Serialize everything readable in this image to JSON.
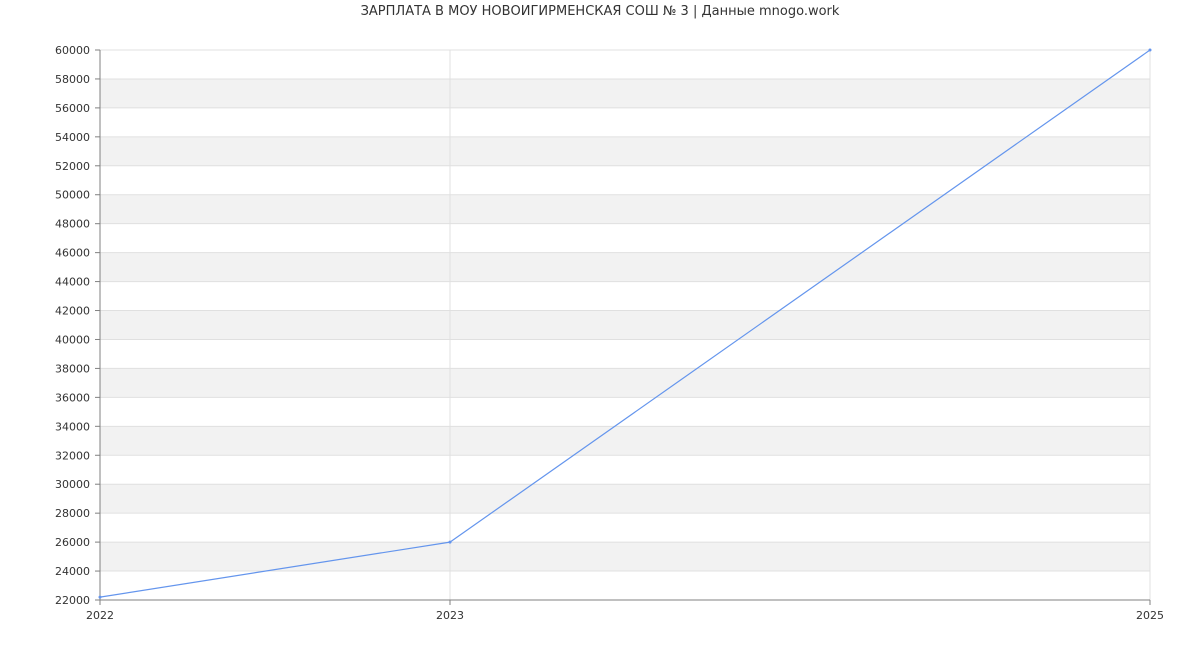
{
  "chart_data": {
    "type": "line",
    "title": "ЗАРПЛАТА В МОУ НОВОИГИРМЕНСКАЯ СОШ № 3 | Данные mnogo.work",
    "xlabel": "",
    "ylabel": "",
    "x": [
      2022,
      2023,
      2025
    ],
    "x_tick_labels": [
      "2022",
      "2023",
      "2025"
    ],
    "series": [
      {
        "values": [
          22200,
          26000,
          60000
        ],
        "color": "#6495ed"
      }
    ],
    "xlim": [
      2022,
      2025
    ],
    "ylim": [
      22000,
      60000
    ],
    "y_ticks": [
      22000,
      24000,
      26000,
      28000,
      30000,
      32000,
      34000,
      36000,
      38000,
      40000,
      42000,
      44000,
      46000,
      48000,
      50000,
      52000,
      54000,
      56000,
      58000,
      60000
    ],
    "grid": true,
    "legend": "none",
    "band_color": "#f2f2f2",
    "grid_color": "#e0e0e0",
    "axis_color": "#808080"
  }
}
